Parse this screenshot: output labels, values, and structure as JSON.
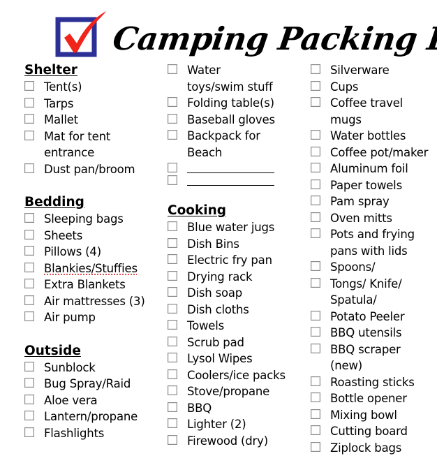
{
  "header": {
    "title": "Camping Packing List",
    "logo_icon": "checkmark-in-box-icon",
    "colors": {
      "box_blue": "#2b2f96",
      "check_red": "#f0241a"
    }
  },
  "columns": [
    {
      "sections": [
        {
          "title": "Shelter",
          "items": [
            {
              "label": "Tent(s)",
              "checked": false
            },
            {
              "label": "Tarps",
              "checked": false
            },
            {
              "label": "Mallet",
              "checked": false
            },
            {
              "label": "Mat for tent entrance",
              "checked": false
            },
            {
              "label": "Dust pan/broom",
              "checked": false
            }
          ]
        },
        {
          "title": "Bedding",
          "items": [
            {
              "label": "Sleeping bags",
              "checked": false
            },
            {
              "label": "Sheets",
              "checked": false
            },
            {
              "label": "Pillows (4)",
              "checked": false
            },
            {
              "label": "Blankies/Stuffies",
              "checked": false,
              "mark": "spell"
            },
            {
              "label": "Extra Blankets",
              "checked": false
            },
            {
              "label": "Air mattresses (3)",
              "checked": false
            },
            {
              "label": "Air pump",
              "checked": false
            }
          ]
        },
        {
          "title": "Outside",
          "items": [
            {
              "label": "Sunblock",
              "checked": false
            },
            {
              "label": "Bug Spray/Raid",
              "checked": false
            },
            {
              "label": "Aloe vera",
              "checked": false
            },
            {
              "label": "Lantern/propane",
              "checked": false
            },
            {
              "label": "Flashlights",
              "checked": false
            }
          ]
        }
      ]
    },
    {
      "sections": [
        {
          "title": "",
          "items": [
            {
              "label": "Water toys/swim stuff",
              "checked": false
            },
            {
              "label": "Folding table(s)",
              "checked": false
            },
            {
              "label": "Baseball gloves",
              "checked": false
            },
            {
              "label": "Backpack for Beach",
              "checked": false
            },
            {
              "label": "",
              "checked": false,
              "blank": true
            },
            {
              "label": "",
              "checked": false,
              "blank": true
            }
          ]
        },
        {
          "title": "Cooking",
          "items": [
            {
              "label": "Blue water jugs",
              "checked": false
            },
            {
              "label": "Dish Bins",
              "checked": false
            },
            {
              "label": "Electric fry pan",
              "checked": false
            },
            {
              "label": "Drying rack",
              "checked": false
            },
            {
              "label": "Dish soap",
              "checked": false
            },
            {
              "label": "Dish cloths",
              "checked": false
            },
            {
              "label": "Towels",
              "checked": false
            },
            {
              "label": "Scrub pad",
              "checked": false
            },
            {
              "label": "Lysol Wipes",
              "checked": false
            },
            {
              "label": "Coolers/ice packs",
              "checked": false
            },
            {
              "label": "Stove/propane",
              "checked": false
            },
            {
              "label": "BBQ",
              "checked": false
            },
            {
              "label": "Lighter (2)",
              "checked": false
            },
            {
              "label": "Firewood (dry)",
              "checked": false
            }
          ]
        }
      ]
    },
    {
      "sections": [
        {
          "title": "",
          "items": [
            {
              "label": "Silverware",
              "checked": false
            },
            {
              "label": "Cups",
              "checked": false
            },
            {
              "label": "Coffee travel mugs",
              "checked": false
            },
            {
              "label": "Water bottles",
              "checked": false
            },
            {
              "label": "Coffee pot/maker",
              "checked": false
            },
            {
              "label": "Aluminum foil",
              "checked": false
            },
            {
              "label": "Paper towels",
              "checked": false
            },
            {
              "label": "Pam spray",
              "checked": false
            },
            {
              "label": "Oven mitts",
              "checked": false
            },
            {
              "label": "Pots and frying pans with lids",
              "checked": false
            },
            {
              "label": "Spoons/",
              "checked": false
            },
            {
              "label": "Tongs/ Knife/ Spatula/",
              "checked": false
            },
            {
              "label": "Potato Peeler",
              "checked": false
            },
            {
              "label": "BBQ utensils",
              "checked": false
            },
            {
              "label": "BBQ scraper (new)",
              "checked": false
            },
            {
              "label": "Roasting sticks",
              "checked": false
            },
            {
              "label": "Bottle opener",
              "checked": false
            },
            {
              "label": "Mixing bowl",
              "checked": false
            },
            {
              "label": "Cutting board",
              "checked": false
            },
            {
              "label": "Ziplock bags",
              "checked": false
            }
          ]
        }
      ]
    }
  ]
}
